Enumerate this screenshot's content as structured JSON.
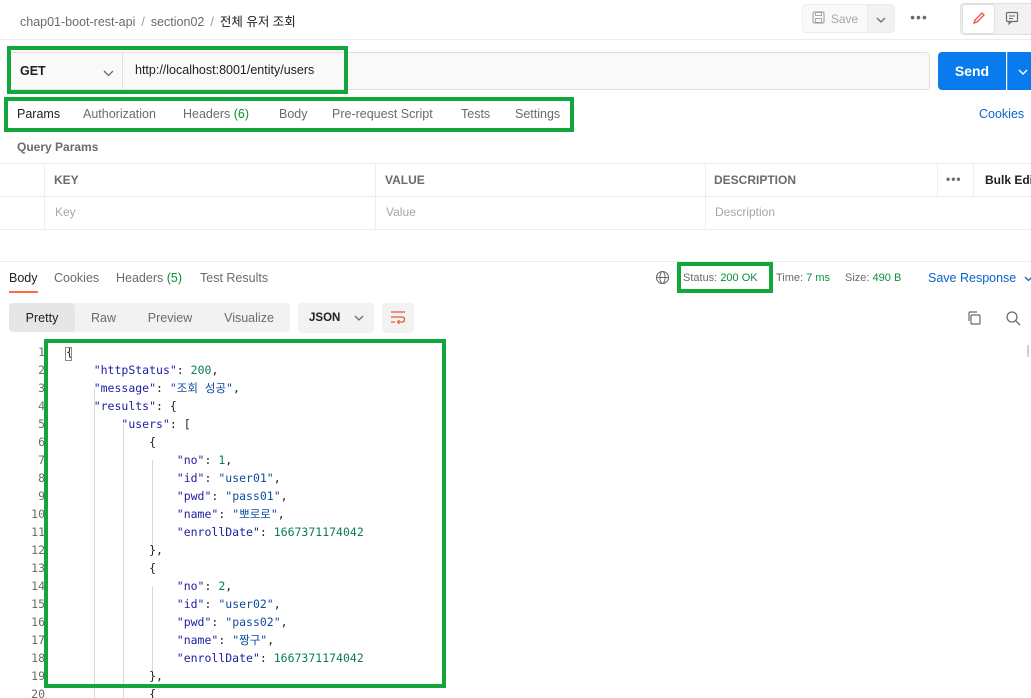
{
  "breadcrumb": {
    "collection": "chap01-boot-rest-api",
    "folder": "section02",
    "request": "전체 유저 조회",
    "separator": "/"
  },
  "toolbar": {
    "save_label": "Save",
    "more_label": "•••"
  },
  "request": {
    "method": "GET",
    "url": "http://localhost:8001/entity/users",
    "send_label": "Send"
  },
  "request_tabs": [
    {
      "label": "Params",
      "count": ""
    },
    {
      "label": "Authorization",
      "count": ""
    },
    {
      "label": "Headers",
      "count": "(6)"
    },
    {
      "label": "Body",
      "count": ""
    },
    {
      "label": "Pre-request Script",
      "count": ""
    },
    {
      "label": "Tests",
      "count": ""
    },
    {
      "label": "Settings",
      "count": ""
    }
  ],
  "cookies_label": "Cookies",
  "query_params": {
    "title": "Query Params",
    "headers": [
      "KEY",
      "VALUE",
      "DESCRIPTION"
    ],
    "more": "•••",
    "bulk_edit": "Bulk Edit",
    "placeholders": [
      "Key",
      "Value",
      "Description"
    ]
  },
  "response_tabs": [
    {
      "label": "Body",
      "count": ""
    },
    {
      "label": "Cookies",
      "count": ""
    },
    {
      "label": "Headers",
      "count": "(5)"
    },
    {
      "label": "Test Results",
      "count": ""
    }
  ],
  "response_meta": {
    "status_label": "Status:",
    "status_value": "200 OK",
    "time_label": "Time:",
    "time_value": "7 ms",
    "size_label": "Size:",
    "size_value": "490 B",
    "save_response": "Save Response"
  },
  "view_modes": [
    "Pretty",
    "Raw",
    "Preview",
    "Visualize"
  ],
  "format": "JSON",
  "code_lines": [
    {
      "n": "1",
      "t": "{"
    },
    {
      "n": "2",
      "t": "    \"httpStatus\": 200,"
    },
    {
      "n": "3",
      "t": "    \"message\": \"조회 성공\","
    },
    {
      "n": "4",
      "t": "    \"results\": {"
    },
    {
      "n": "5",
      "t": "        \"users\": ["
    },
    {
      "n": "6",
      "t": "            {"
    },
    {
      "n": "7",
      "t": "                \"no\": 1,"
    },
    {
      "n": "8",
      "t": "                \"id\": \"user01\","
    },
    {
      "n": "9",
      "t": "                \"pwd\": \"pass01\","
    },
    {
      "n": "10",
      "t": "                \"name\": \"뽀로로\","
    },
    {
      "n": "11",
      "t": "                \"enrollDate\": 1667371174042"
    },
    {
      "n": "12",
      "t": "            },"
    },
    {
      "n": "13",
      "t": "            {"
    },
    {
      "n": "14",
      "t": "                \"no\": 2,"
    },
    {
      "n": "15",
      "t": "                \"id\": \"user02\","
    },
    {
      "n": "16",
      "t": "                \"pwd\": \"pass02\","
    },
    {
      "n": "17",
      "t": "                \"name\": \"짱구\","
    },
    {
      "n": "18",
      "t": "                \"enrollDate\": 1667371174042"
    },
    {
      "n": "19",
      "t": "            },"
    },
    {
      "n": "20",
      "t": "            {"
    }
  ],
  "colors": {
    "accent": "#097bed",
    "highlight": "#12a63c",
    "status_ok": "#0a8f3a",
    "tab_underline": "#ff6c37"
  }
}
